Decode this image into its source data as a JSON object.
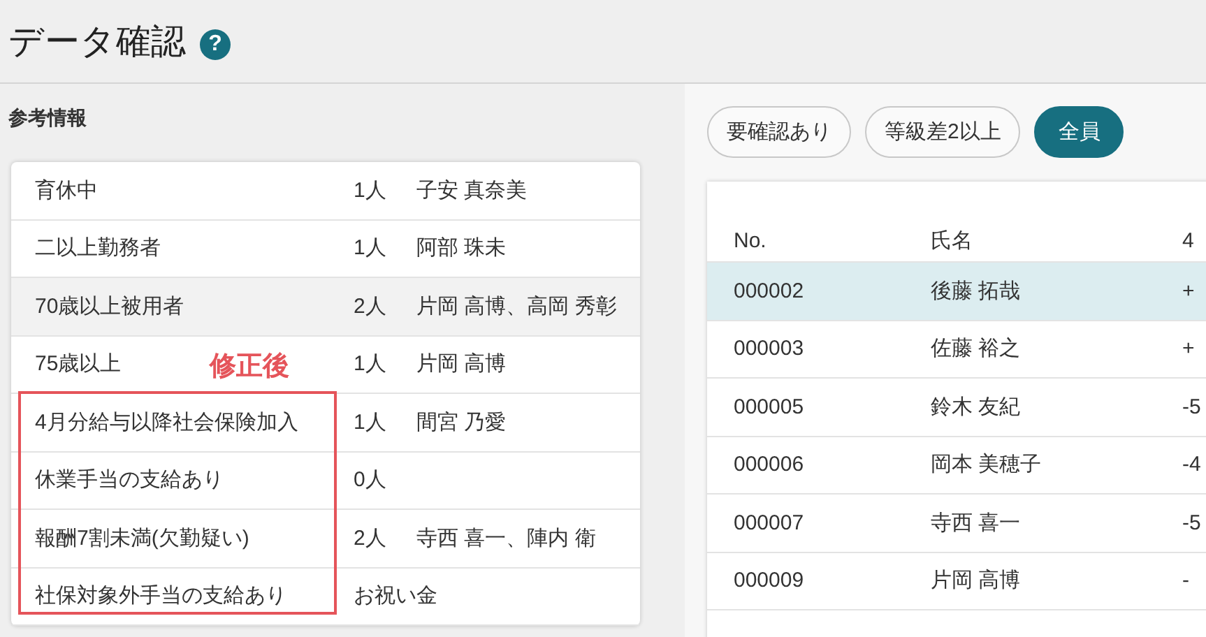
{
  "header": {
    "title": "データ確認",
    "help_icon": "?"
  },
  "reference": {
    "title": "参考情報",
    "rows": [
      {
        "label": "育休中",
        "count": "1人",
        "names": "子安 真奈美",
        "highlighted": false
      },
      {
        "label": "二以上勤務者",
        "count": "1人",
        "names": "阿部 珠未",
        "highlighted": false
      },
      {
        "label": "70歳以上被用者",
        "count": "2人",
        "names": "片岡 高博、高岡 秀彰",
        "highlighted": true
      },
      {
        "label": "75歳以上",
        "count": "1人",
        "names": "片岡 高博",
        "highlighted": false
      }
    ],
    "annotated_group": {
      "note": "修正後",
      "rows": [
        {
          "label": "4月分給与以降社会保険加入",
          "count": "1人",
          "names": "間宮 乃愛",
          "highlighted": false
        },
        {
          "label": "休業手当の支給あり",
          "count": "0人",
          "highlighted": false
        },
        {
          "label": "報酬7割未満(欠勤疑い)",
          "count": "2人",
          "names": "寺西 喜一、陣内 衛",
          "highlighted": false
        },
        {
          "label": "社保対象外手当の支給あり",
          "count": "お祝い金",
          "highlighted": false
        }
      ]
    }
  },
  "filters": [
    {
      "label": "要確認あり",
      "selected": false
    },
    {
      "label": "等級差2以上",
      "selected": false
    },
    {
      "label": "全員",
      "selected": true
    }
  ],
  "table": {
    "columns": [
      "No.",
      "氏名",
      "4"
    ],
    "rows": [
      {
        "cells": [
          "000002",
          "後藤 拓哉",
          "+"
        ],
        "selected": true
      },
      {
        "cells": [
          "000003",
          "佐藤 裕之",
          "+"
        ],
        "selected": false
      },
      {
        "cells": [
          "000005",
          "鈴木 友紀",
          "-5"
        ],
        "selected": false
      },
      {
        "cells": [
          "000006",
          "岡本 美穂子",
          "-4"
        ],
        "selected": false
      },
      {
        "cells": [
          "000007",
          "寺西 喜一",
          "-5"
        ],
        "selected": false
      },
      {
        "cells": [
          "000009",
          "片岡 高博",
          "-"
        ],
        "selected": false
      }
    ]
  }
}
